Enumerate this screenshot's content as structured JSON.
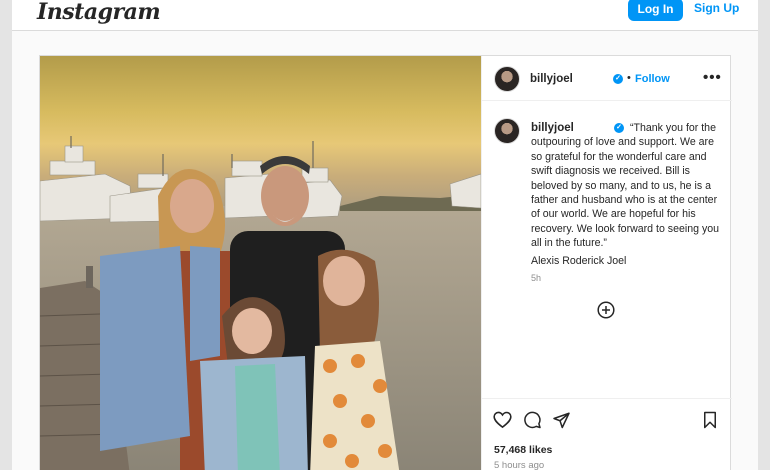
{
  "header": {
    "logo": "Instagram",
    "login_label": "Log In",
    "signup_label": "Sign Up"
  },
  "post": {
    "username": "billyjoel",
    "separator": "•",
    "follow_label": "Follow",
    "more_label": "•••",
    "caption": "“Thank you for the outpouring of love and support.  We are so grateful for the wonderful care and swift diagnosis we received.  Bill is beloved by so many, and to us, he is a father and husband who is at the center of our world. We are hopeful for his recovery. We look forward to seeing you all in the future.”",
    "signature": "Alexis Roderick Joel",
    "caption_age": "5h",
    "likes": "57,468 likes",
    "posted": "5 hours ago"
  },
  "icons": {
    "verified": "verified-badge-icon",
    "more": "more-options-icon",
    "load_more": "plus-circle-icon",
    "like": "heart-icon",
    "comment": "comment-icon",
    "share": "share-icon",
    "save": "bookmark-icon"
  },
  "colors": {
    "accent": "#0095f6",
    "text": "#262626",
    "muted": "#8e8e8e",
    "border": "#dbdbdb"
  }
}
